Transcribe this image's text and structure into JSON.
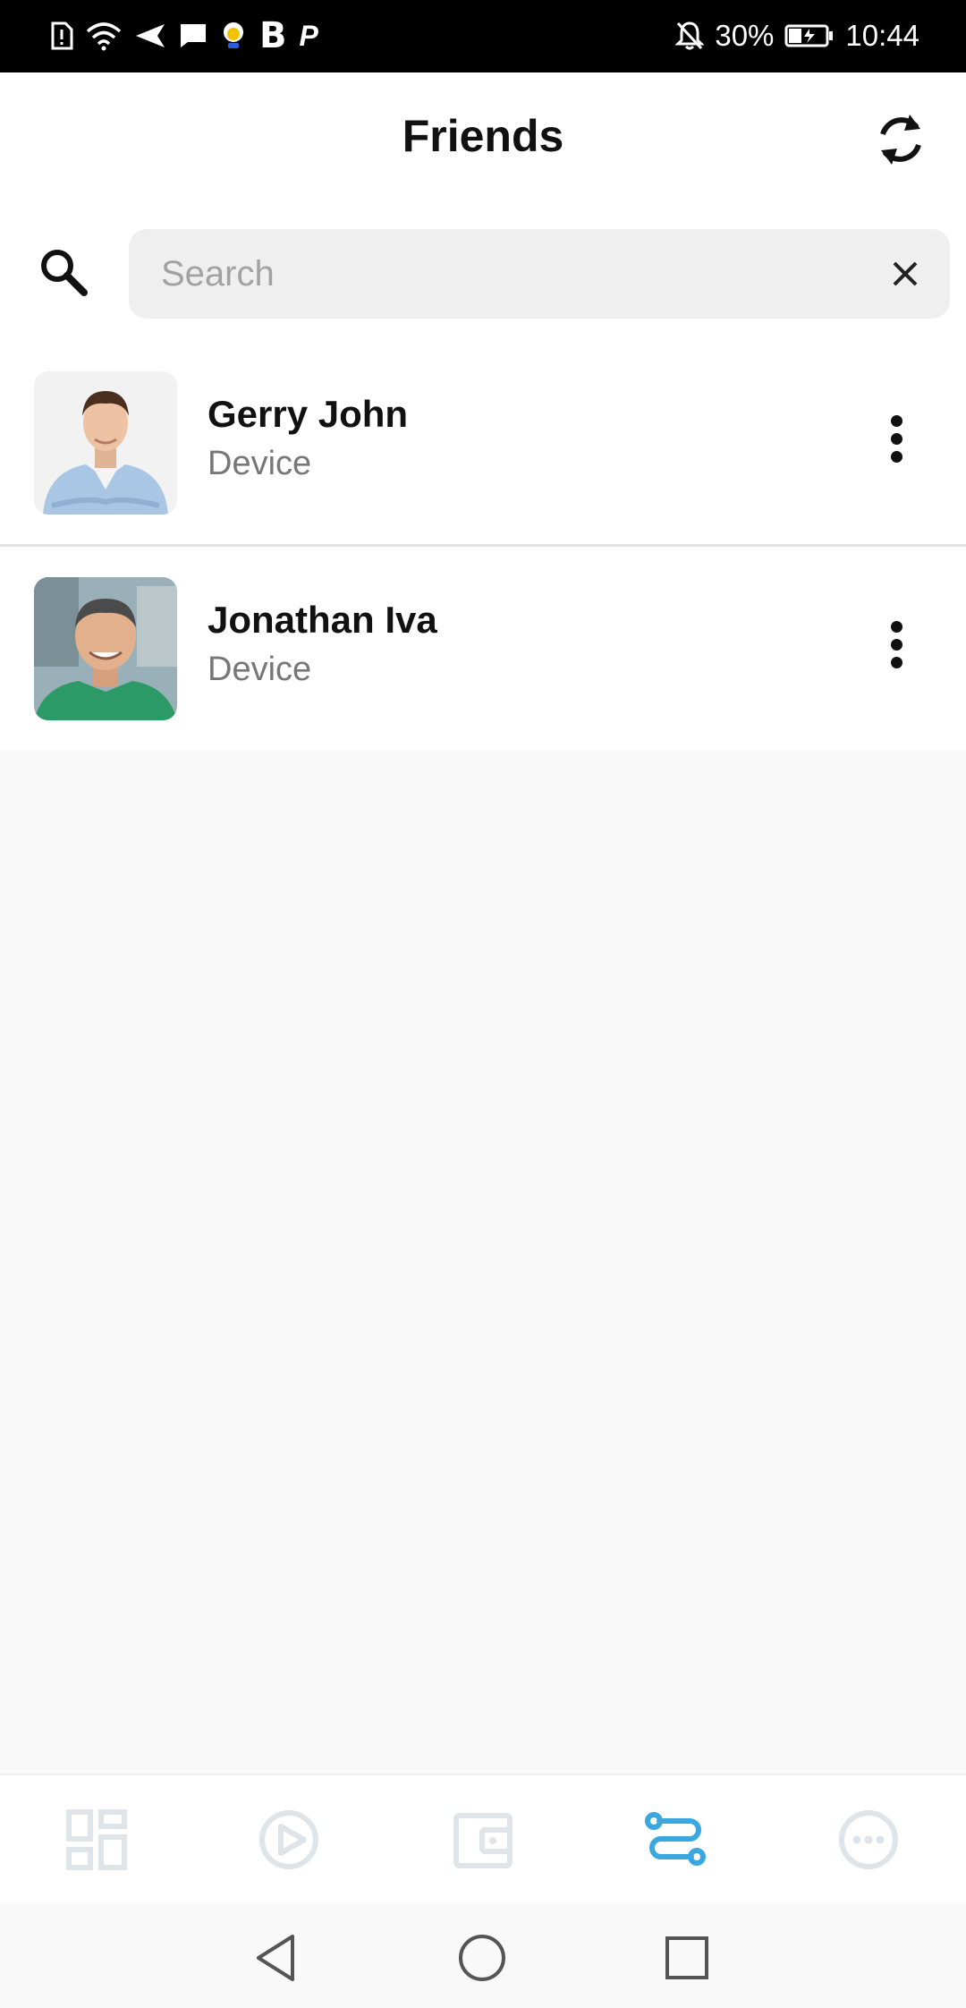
{
  "status_bar": {
    "battery": "30%",
    "time": "10:44",
    "b_label": "B",
    "p_label": "P"
  },
  "header": {
    "title": "Friends"
  },
  "search": {
    "placeholder": "Search"
  },
  "friends": [
    {
      "name": "Gerry John",
      "subtitle": "Device"
    },
    {
      "name": "Jonathan Iva",
      "subtitle": "Device"
    }
  ],
  "bottom_nav": {
    "items": [
      {
        "icon": "dashboard-icon",
        "active": false
      },
      {
        "icon": "play-circle-icon",
        "active": false
      },
      {
        "icon": "wallet-icon",
        "active": false
      },
      {
        "icon": "route-icon",
        "active": true
      },
      {
        "icon": "more-circle-icon",
        "active": false
      }
    ]
  },
  "colors": {
    "accent": "#3aa7e0",
    "inactive_icon": "#dfe4e8"
  }
}
